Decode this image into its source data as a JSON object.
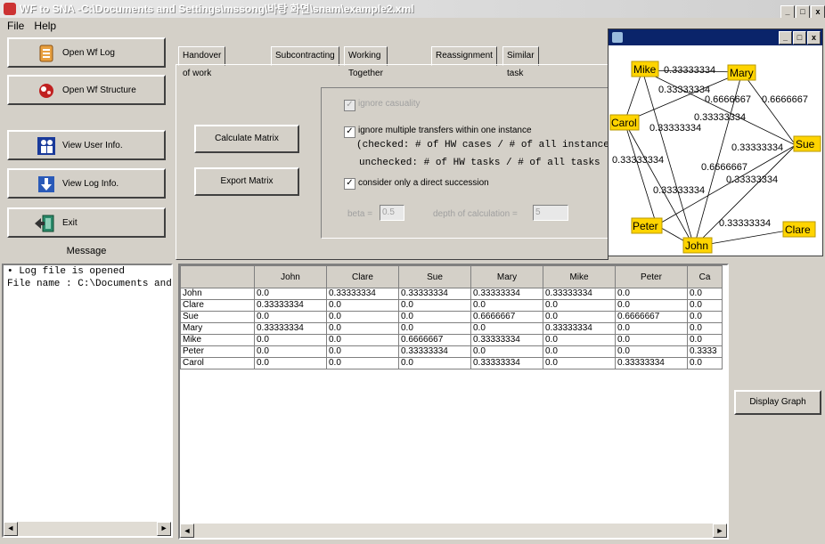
{
  "window": {
    "title": "WF to SNA -C:\\Documents and Settings\\mssong\\바탕 화면\\snam\\example2.xml"
  },
  "menu": {
    "file": "File",
    "help": "Help"
  },
  "left_buttons": [
    {
      "label": "Open Wf Log",
      "icon": "log-icon"
    },
    {
      "label": "Open Wf Structure",
      "icon": "structure-icon"
    },
    {
      "label": "View User Info.",
      "icon": "users-icon"
    },
    {
      "label": "View Log Info.",
      "icon": "download-icon"
    },
    {
      "label": "Exit",
      "icon": "exit-icon"
    }
  ],
  "message": {
    "label": "Message",
    "lines": [
      "• Log file is opened",
      "File name : C:\\Documents and"
    ]
  },
  "tabs": [
    "Handover of work",
    "Subcontracting",
    "Working Together",
    "Reassignment",
    "Similar task"
  ],
  "active_tab": "Handover of work",
  "actions": {
    "calculate": "Calculate Matrix",
    "export": "Export Matrix",
    "display_graph": "Display Graph"
  },
  "options": {
    "ignore_causality": {
      "label": "ignore casuality",
      "checked": true,
      "enabled": false
    },
    "ignore_multiple": {
      "label": "ignore multiple transfers within one instance",
      "checked": true
    },
    "checked_note": "(checked: # of HW cases / # of all instances",
    "unchecked_note": "unchecked: # of HW tasks / # of all tasks )",
    "direct_succession": {
      "label": "consider only a direct succession",
      "checked": true
    },
    "beta_label": "beta =",
    "beta_value": "0.5",
    "depth_label": "depth of calculation =",
    "depth_value": "5"
  },
  "matrix": {
    "columns": [
      "John",
      "Clare",
      "Sue",
      "Mary",
      "Mike",
      "Peter",
      "Ca"
    ],
    "rows": [
      {
        "name": "John",
        "values": [
          "0.0",
          "0.33333334",
          "0.33333334",
          "0.33333334",
          "0.33333334",
          "0.0",
          "0.0"
        ]
      },
      {
        "name": "Clare",
        "values": [
          "0.33333334",
          "0.0",
          "0.0",
          "0.0",
          "0.0",
          "0.0",
          "0.0"
        ]
      },
      {
        "name": "Sue",
        "values": [
          "0.0",
          "0.0",
          "0.0",
          "0.6666667",
          "0.0",
          "0.6666667",
          "0.0"
        ]
      },
      {
        "name": "Mary",
        "values": [
          "0.33333334",
          "0.0",
          "0.0",
          "0.0",
          "0.33333334",
          "0.0",
          "0.0"
        ]
      },
      {
        "name": "Mike",
        "values": [
          "0.0",
          "0.0",
          "0.6666667",
          "0.33333334",
          "0.0",
          "0.0",
          "0.0"
        ]
      },
      {
        "name": "Peter",
        "values": [
          "0.0",
          "0.0",
          "0.33333334",
          "0.0",
          "0.0",
          "0.0",
          "0.3333"
        ]
      },
      {
        "name": "Carol",
        "values": [
          "0.0",
          "0.0",
          "0.0",
          "0.33333334",
          "0.0",
          "0.33333334",
          "0.0"
        ]
      }
    ]
  },
  "graph": {
    "nodes": [
      "Mike",
      "Mary",
      "Carol",
      "Sue",
      "Peter",
      "John",
      "Clare"
    ],
    "edge_labels": [
      "0.33333334",
      "0.33333334",
      "0.6666667",
      "0.6666667",
      "0.33333334",
      "0.33333334",
      "0.33333334",
      "0.33333334",
      "0.6666667",
      "0.33333334",
      "0.33333334",
      "0.33333334"
    ]
  },
  "colors": {
    "node_fill": "#ffd400",
    "titlebar_active": "#0a246a"
  }
}
